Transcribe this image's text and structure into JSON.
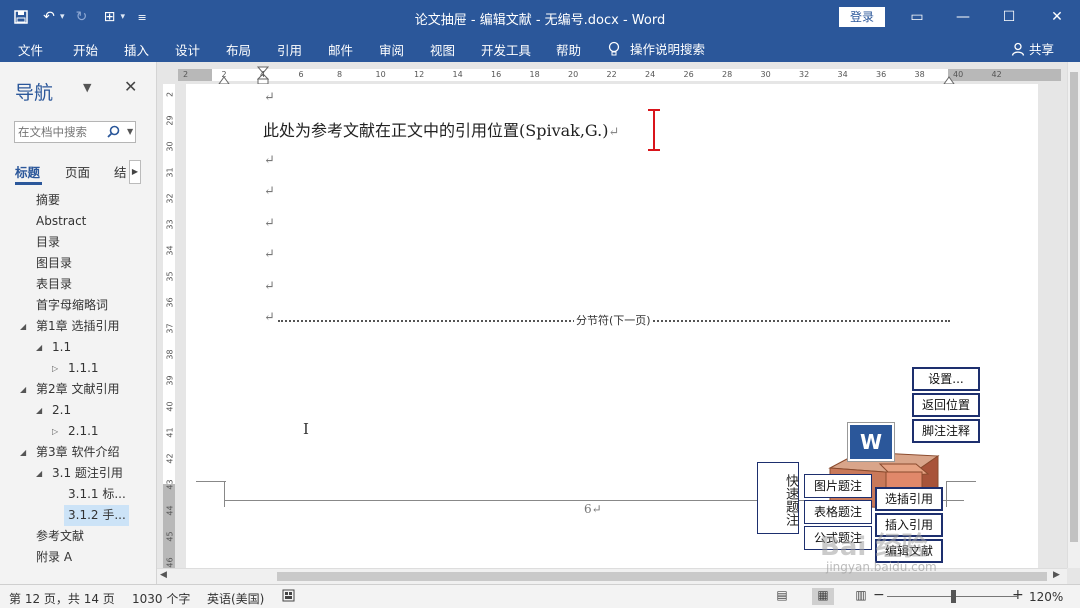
{
  "window": {
    "title": "论文抽屉 - 编辑文献 - 无编号.docx  -  Word",
    "login_label": "登录",
    "controls": {
      "ribbon_display": "▭",
      "minimize": "—",
      "maximize": "☐",
      "close": "✕"
    }
  },
  "quick_access": {
    "save": "save-icon",
    "undo": "undo-icon",
    "redo": "redo-icon",
    "table": "table-icon",
    "customize": "customize-icon"
  },
  "menu": {
    "tabs": [
      "文件",
      "开始",
      "插入",
      "设计",
      "布局",
      "引用",
      "邮件",
      "审阅",
      "视图",
      "开发工具",
      "帮助"
    ],
    "tell_me": "操作说明搜索",
    "share": "共享"
  },
  "nav": {
    "title": "导航",
    "search_placeholder": "在文档中搜索",
    "tabs": [
      "标题",
      "页面",
      "结"
    ],
    "items": [
      {
        "label": "摘要",
        "level": 1,
        "arrow": ""
      },
      {
        "label": "Abstract",
        "level": 1,
        "arrow": ""
      },
      {
        "label": "目录",
        "level": 1,
        "arrow": ""
      },
      {
        "label": "图目录",
        "level": 1,
        "arrow": ""
      },
      {
        "label": "表目录",
        "level": 1,
        "arrow": ""
      },
      {
        "label": "首字母缩略词",
        "level": 1,
        "arrow": ""
      },
      {
        "label": "第1章 选插引用",
        "level": 1,
        "arrow": "◢"
      },
      {
        "label": "1.1",
        "level": 2,
        "arrow": "◢"
      },
      {
        "label": "1.1.1",
        "level": 3,
        "arrow": "▷"
      },
      {
        "label": "第2章 文献引用",
        "level": 1,
        "arrow": "◢"
      },
      {
        "label": "2.1",
        "level": 2,
        "arrow": "◢"
      },
      {
        "label": "2.1.1",
        "level": 3,
        "arrow": "▷"
      },
      {
        "label": "第3章 软件介绍",
        "level": 1,
        "arrow": "◢"
      },
      {
        "label": "3.1 题注引用",
        "level": 2,
        "arrow": "◢"
      },
      {
        "label": "3.1.1 标...",
        "level": 3,
        "arrow": ""
      },
      {
        "label": "3.1.2 手...",
        "level": 3,
        "arrow": "",
        "selected": true
      },
      {
        "label": "参考文献",
        "level": 1,
        "arrow": ""
      },
      {
        "label": "附录 A",
        "level": 1,
        "arrow": ""
      }
    ]
  },
  "ruler": {
    "h_numbers": [
      "2",
      "2",
      "4",
      "6",
      "8",
      "10",
      "12",
      "14",
      "16",
      "18",
      "20",
      "22",
      "24",
      "26",
      "28",
      "30",
      "32",
      "34",
      "36",
      "38",
      "40",
      "42"
    ],
    "v_numbers": [
      "2",
      "29",
      "30",
      "31",
      "32",
      "33",
      "34",
      "35",
      "36",
      "37",
      "38",
      "39",
      "40",
      "41",
      "42",
      "43",
      "44",
      "45",
      "46"
    ]
  },
  "document": {
    "body_text": "此处为参考文献在正文中的引用位置(Spivak,G.)",
    "paragraph_mark": "↵",
    "section_break_label": "分节符(下一页)",
    "page_number": "6↵"
  },
  "toolbox": {
    "settings": "设置...",
    "return": "返回位置",
    "footnote": "脚注注释",
    "quick_caption": "快速题注",
    "figure_caption": "图片题注",
    "table_caption": "表格题注",
    "formula_caption": "公式题注",
    "select_ref": "选插引用",
    "insert_ref": "插入引用",
    "edit_ref": "编辑文献",
    "word_logo": "W"
  },
  "status": {
    "page": "第 12 页，共 14 页",
    "words": "1030 个字",
    "language": "英语(美国)",
    "zoom": "120%",
    "zoom_out": "−",
    "zoom_in": "+"
  },
  "watermark": {
    "main": "Bai 经验",
    "url": "jingyan.baidu.com"
  }
}
